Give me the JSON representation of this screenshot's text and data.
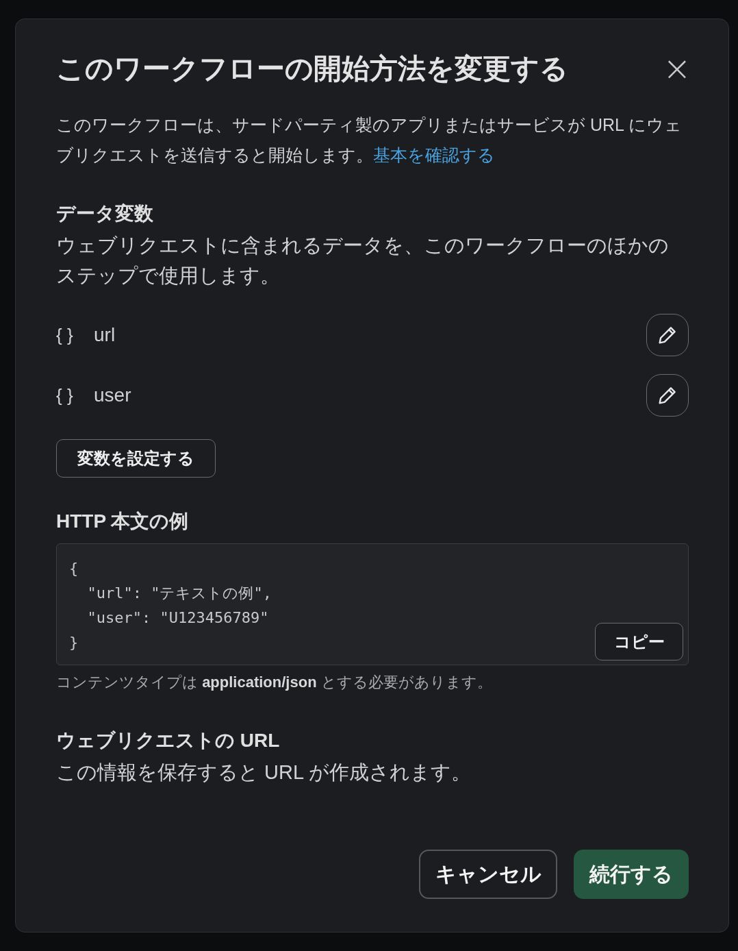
{
  "dialog": {
    "title": "このワークフローの開始方法を変更する",
    "close": "×",
    "intro": {
      "text": "このワークフローは、サードパーティ製のアプリまたはサービスが URL にウェブリクエストを送信すると開始します。",
      "link": "基本を確認する"
    }
  },
  "data_variables": {
    "heading": "データ変数",
    "description": "ウェブリクエストに含まれるデータを、このワークフローのほかのステップで使用します。",
    "items": [
      {
        "icon": "{ }",
        "name": "url"
      },
      {
        "icon": "{ }",
        "name": "user"
      }
    ],
    "button": "変数を設定する"
  },
  "http_body": {
    "heading": "HTTP 本文の例",
    "code_lines": [
      "{",
      "  \"url\": \"テキストの例\",",
      "  \"user\": \"U123456789\"",
      "}"
    ],
    "copy_button": "コピー",
    "note": "コンテンツタイプは **application/json** とする必要があります。"
  },
  "webhook_url": {
    "heading": "ウェブリクエストの URL",
    "text": "この情報を保存すると URL が作成されます。"
  },
  "buttons": [
    {
      "label": "キャンセル",
      "kind": "secondary"
    },
    {
      "label": "続行する",
      "kind": "primary"
    }
  ]
}
